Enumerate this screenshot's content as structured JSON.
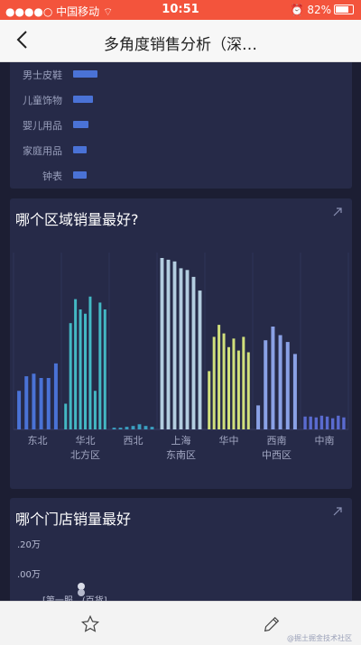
{
  "status": {
    "carrier": "中国移动",
    "time": "10:51",
    "battery": "82%"
  },
  "nav": {
    "title": "多角度销售分析（深…"
  },
  "category_card": {
    "items": [
      {
        "label": "男士皮鞋",
        "value": 0.27
      },
      {
        "label": "儿童饰物",
        "value": 0.22
      },
      {
        "label": "婴儿用品",
        "value": 0.17
      },
      {
        "label": "家庭用品",
        "value": 0.15
      },
      {
        "label": "钟表",
        "value": 0.15
      }
    ]
  },
  "region_card": {
    "title": "哪个区域销量最好?"
  },
  "store_card": {
    "title": "哪个门店销量最好",
    "y_ticks": [
      ".20万",
      ".00万"
    ],
    "x_label": "[第一服…(百货]"
  },
  "watermark": "@掘土掘金技术社区",
  "colors": {
    "accent": "#f3543c",
    "bar": "#4a72d6"
  },
  "chart_data": {
    "type": "bar",
    "title": "哪个区域销量最好?",
    "x_ticks": [
      "东北",
      "华北",
      "西北",
      "上海",
      "华中",
      "西南",
      "中南"
    ],
    "groups": [
      "北方区",
      "东南区",
      "中西区"
    ],
    "ylim": [
      0,
      200
    ],
    "series": [
      {
        "values": [
          45,
          62,
          65,
          60,
          60,
          77
        ]
      },
      {
        "values": [
          30,
          124,
          152,
          140,
          135,
          155,
          45,
          148,
          140
        ]
      },
      {
        "values": [
          2,
          2,
          3,
          4,
          6,
          4,
          3
        ]
      },
      {
        "values": [
          200,
          198,
          196,
          188,
          186,
          178,
          162
        ]
      },
      {
        "values": [
          68,
          108,
          122,
          112,
          96,
          106,
          92,
          108,
          90
        ]
      },
      {
        "values": [
          28,
          104,
          120,
          110,
          102,
          88
        ]
      },
      {
        "values": [
          15,
          15,
          14,
          16,
          15,
          13,
          16,
          14
        ]
      }
    ],
    "series_colors": [
      "#4a72d6",
      "#43b8c4",
      "#3a9fc0",
      "#b3cde0",
      "#d1e07c",
      "#8aa1e6",
      "#5a6bd0"
    ]
  }
}
